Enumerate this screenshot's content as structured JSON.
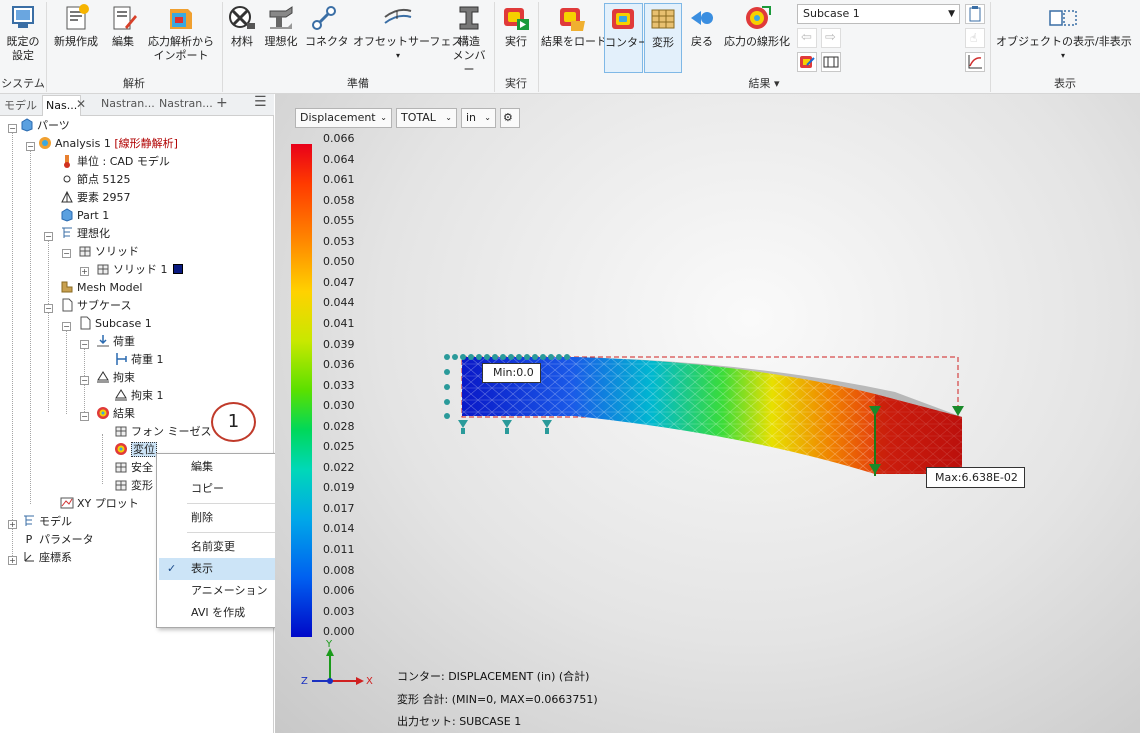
{
  "ribbon": {
    "buttons": {
      "settings": "既定の\n設定",
      "new": "新規作成",
      "edit": "編集",
      "import": "応力解析から\nインポート",
      "material": "材料",
      "idealize": "理想化",
      "connector": "コネクタ",
      "offset": "オフセットサーフェス",
      "member": "構造\nメンバー",
      "run": "実行",
      "load_results": "結果をロード",
      "contour": "コンター",
      "deform": "変形",
      "back": "戻る",
      "linearize": "応力の線形化",
      "show_hide": "オブジェクトの表示/非表示"
    },
    "groups": {
      "system": "システム",
      "analysis": "解析",
      "prepare": "準備",
      "execute": "実行",
      "results": "結果 ▾",
      "display": "表示"
    },
    "subcase_select": "Subcase 1"
  },
  "tabs": [
    "モデル",
    "Nas...",
    "Nastran...",
    "Nastran..."
  ],
  "tree": {
    "parts": "パーツ",
    "analysis": "Analysis 1",
    "analysis_type": "[線形静解析]",
    "unit": "単位 : CAD モデル",
    "nodes": "節点 5125",
    "elements": "要素 2957",
    "part1": "Part 1",
    "idealize": "理想化",
    "solids": "ソリッド",
    "solid1": "ソリッド 1",
    "mesh": "Mesh Model",
    "subcases": "サブケース",
    "subcase1": "Subcase 1",
    "loads": "荷重",
    "load1": "荷重 1",
    "constraints": "拘束",
    "constraint1": "拘束 1",
    "results": "結果",
    "vonmises": "フォン ミーゼス",
    "disp": "変位",
    "safety": "安全",
    "deform": "変形",
    "xyplot": "XY プロット",
    "model": "モデル",
    "params": "パラメータ",
    "coords": "座標系",
    "callout": "1"
  },
  "context_menu": {
    "edit": "編集",
    "copy": "コピー",
    "delete": "削除",
    "rename": "名前変更",
    "show": "表示",
    "animation": "アニメーション",
    "avi": "AVI を作成",
    "show_checked": true
  },
  "viewport": {
    "result_type": "Displacement",
    "component": "TOTAL",
    "unit": "in",
    "legend": [
      "0.066",
      "0.064",
      "0.061",
      "0.058",
      "0.055",
      "0.053",
      "0.050",
      "0.047",
      "0.044",
      "0.041",
      "0.039",
      "0.036",
      "0.033",
      "0.030",
      "0.028",
      "0.025",
      "0.022",
      "0.019",
      "0.017",
      "0.014",
      "0.011",
      "0.008",
      "0.006",
      "0.003",
      "0.000"
    ],
    "min_label": "Min:0.0",
    "max_label": "Max:6.638E-02",
    "axis": {
      "x": "X",
      "y": "Y",
      "z": "Z"
    },
    "info": {
      "contour": "コンター: DISPLACEMENT (in) (合計)",
      "deform": "変形  合計: (MIN=0, MAX=0.0663751)",
      "output": "出力セット: SUBCASE 1"
    }
  },
  "colors": {
    "accent": "#1e6fc8",
    "menu_selected": "#cce4f7",
    "analysis_type": "#b00000"
  }
}
